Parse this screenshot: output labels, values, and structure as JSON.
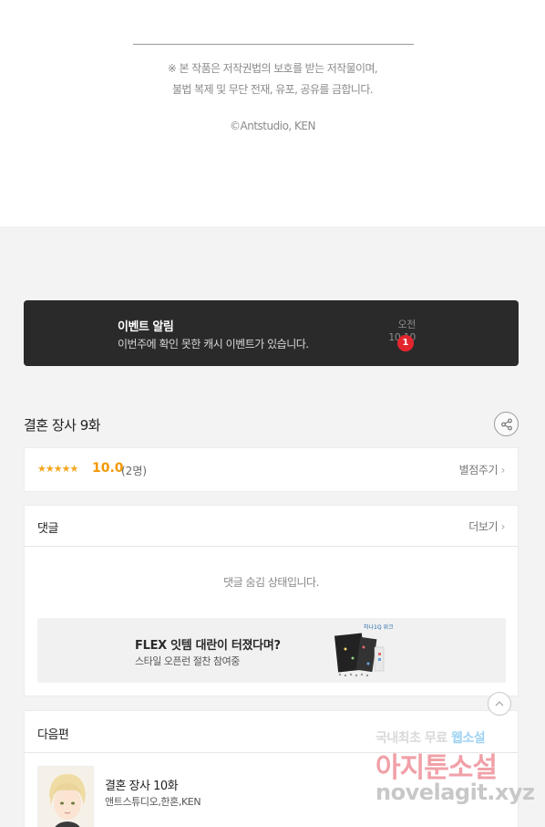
{
  "copyright": {
    "line1": "※ 본 작품은 저작권법의 보호를 받는 저작물이며,",
    "line2": "불법 복제 및 무단 전재, 유포, 공유를 금합니다.",
    "credit": "©Antstudio, KEN"
  },
  "event_notice": {
    "title": "이벤트 알림",
    "message": "이번주에 확인 못한 캐시 이벤트가 있습니다.",
    "time": "오전 10:10",
    "badge_count": "1"
  },
  "episode": {
    "title": "결혼 장사 9화",
    "share_icon": "share-icon"
  },
  "rating": {
    "stars": "★★★★★",
    "score": "10.0",
    "count": "(2명)",
    "rate_link": "별점주기"
  },
  "comments": {
    "label": "댓글",
    "more": "더보기",
    "hidden_message": "댓글 숨김 상태입니다."
  },
  "banner": {
    "title": "FLEX 잇템 대란이 터졌다며?",
    "subtitle": "스타일 오픈런 절찬 참여중",
    "art_label": "하나1Q 위크"
  },
  "next_episode": {
    "label": "다음편",
    "title": "결혼 장사 10화",
    "authors": "앤트스튜디오,한혼,KEN"
  },
  "watermark": {
    "line1_a": "국내최초 무료",
    "line1_b": "웹소설",
    "line2": "아지툰소설",
    "line3": "novelagit.xyz"
  },
  "colors": {
    "event_bg": "#2a2a2a",
    "badge_red": "#e3262e",
    "star_orange": "#f39800"
  }
}
